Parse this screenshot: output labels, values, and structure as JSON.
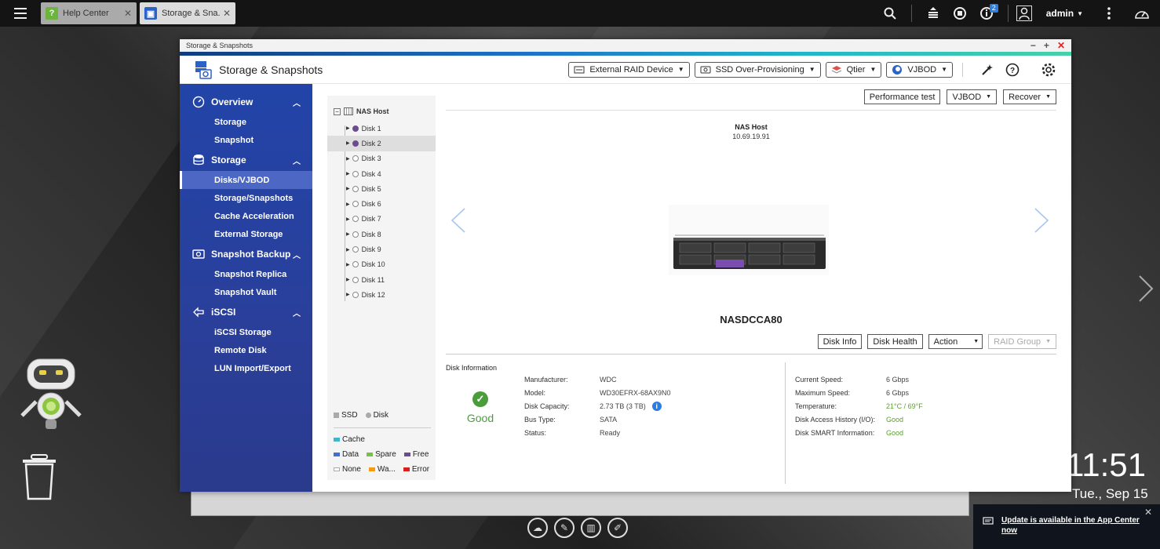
{
  "taskbar": {
    "tabs": [
      {
        "label": "Help Center",
        "active": false,
        "icon": "help-icon"
      },
      {
        "label": "Storage & Sna...",
        "active": true,
        "icon": "storage-icon"
      }
    ],
    "notifications_badge": "2",
    "user": "admin"
  },
  "window": {
    "title": "Storage & Snapshots",
    "app_name": "Storage & Snapshots",
    "header_buttons": {
      "external_raid": "External RAID Device",
      "ssd_over": "SSD Over-Provisioning",
      "qtier": "Qtier",
      "vjbod": "VJBOD"
    }
  },
  "sidebar": {
    "groups": [
      {
        "label": "Overview",
        "items": [
          "Storage",
          "Snapshot"
        ]
      },
      {
        "label": "Storage",
        "items": [
          "Disks/VJBOD",
          "Storage/Snapshots",
          "Cache Acceleration",
          "External Storage"
        ]
      },
      {
        "label": "Snapshot Backup",
        "items": [
          "Snapshot Replica",
          "Snapshot Vault"
        ]
      },
      {
        "label": "iSCSI",
        "items": [
          "iSCSI Storage",
          "Remote Disk",
          "LUN Import/Export"
        ]
      }
    ]
  },
  "tree": {
    "root": "NAS Host",
    "disks": [
      "Disk 1",
      "Disk 2",
      "Disk 3",
      "Disk 4",
      "Disk 5",
      "Disk 6",
      "Disk 7",
      "Disk 8",
      "Disk 9",
      "Disk 10",
      "Disk 11",
      "Disk 12"
    ]
  },
  "legend": {
    "ssd": "SSD",
    "disk": "Disk",
    "cache": "Cache",
    "data": "Data",
    "spare": "Spare",
    "free": "Free",
    "none": "None",
    "warning": "Wa...",
    "error": "Error"
  },
  "top_actions": {
    "performance_test": "Performance test",
    "vjbod": "VJBOD",
    "recover": "Recover"
  },
  "host": {
    "name": "NAS Host",
    "ip": "10.69.19.91",
    "model": "NASDCCA80"
  },
  "disk_actions": {
    "disk_info": "Disk Info",
    "disk_health": "Disk Health",
    "action": "Action",
    "raid_group": "RAID Group"
  },
  "disk_info": {
    "title": "Disk Information",
    "status_label": "Good",
    "left": [
      {
        "k": "Manufacturer:",
        "v": "WDC"
      },
      {
        "k": "Model:",
        "v": "WD30EFRX-68AX9N0"
      },
      {
        "k": "Disk Capacity:",
        "v": "2.73 TB (3 TB)"
      },
      {
        "k": "Bus Type:",
        "v": "SATA"
      },
      {
        "k": "Status:",
        "v": "Ready"
      }
    ],
    "right": [
      {
        "k": "Current Speed:",
        "v": "6 Gbps"
      },
      {
        "k": "Maximum Speed:",
        "v": "6 Gbps"
      },
      {
        "k": "Temperature:",
        "v": "21°C / 69°F"
      },
      {
        "k": "Disk Access History (I/O):",
        "v": "Good"
      },
      {
        "k": "Disk SMART Information:",
        "v": "Good"
      }
    ]
  },
  "clock": {
    "time": "11:51",
    "date": "Tue., Sep 15"
  },
  "notification": {
    "text": "Update is available in the App Center now"
  },
  "colors": {
    "accent": "#2a44a8",
    "good": "#4b9d3c",
    "disk_used": "#6b4c8c"
  }
}
